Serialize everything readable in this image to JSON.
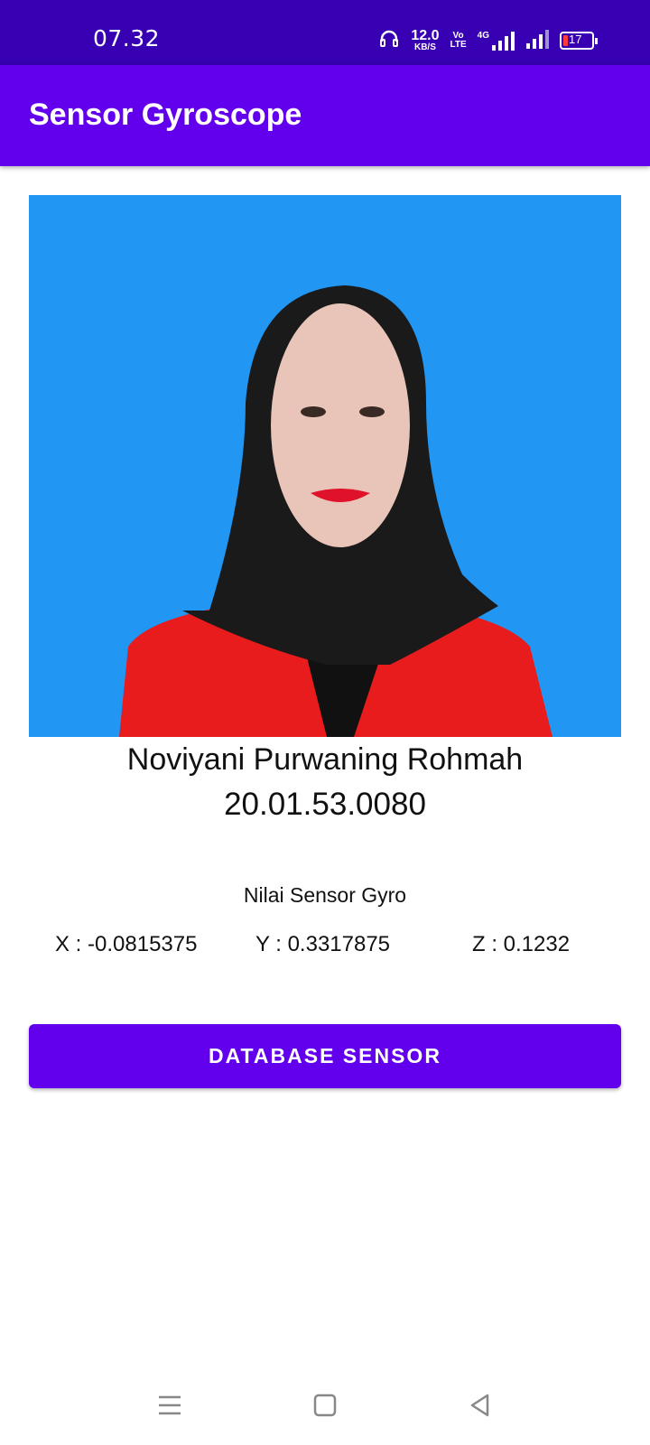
{
  "status_bar": {
    "time": "07.32",
    "net_speed_value": "12.0",
    "net_speed_unit": "KB/S",
    "volte_label_top": "Vo",
    "volte_label_bottom": "LTE",
    "network_type": "4G",
    "battery_level": "17"
  },
  "app_bar": {
    "title": "Sensor Gyroscope"
  },
  "profile": {
    "name": "Noviyani Purwaning Rohmah",
    "nim": "20.01.53.0080"
  },
  "gyro": {
    "heading": "Nilai Sensor Gyro",
    "x_label": "X : -0.0815375",
    "y_label": "Y : 0.3317875",
    "z_label": "Z : 0.1232"
  },
  "actions": {
    "database_button_label": "DATABASE SENSOR"
  },
  "colors": {
    "status_bar": "#3700b3",
    "primary": "#6200ee",
    "photo_background": "#2196f3"
  },
  "icons": {
    "headset": "headset-icon",
    "signal": "signal-icon",
    "battery": "battery-icon",
    "nav_recents": "menu-lines-icon",
    "nav_home": "square-icon",
    "nav_back": "triangle-back-icon"
  }
}
